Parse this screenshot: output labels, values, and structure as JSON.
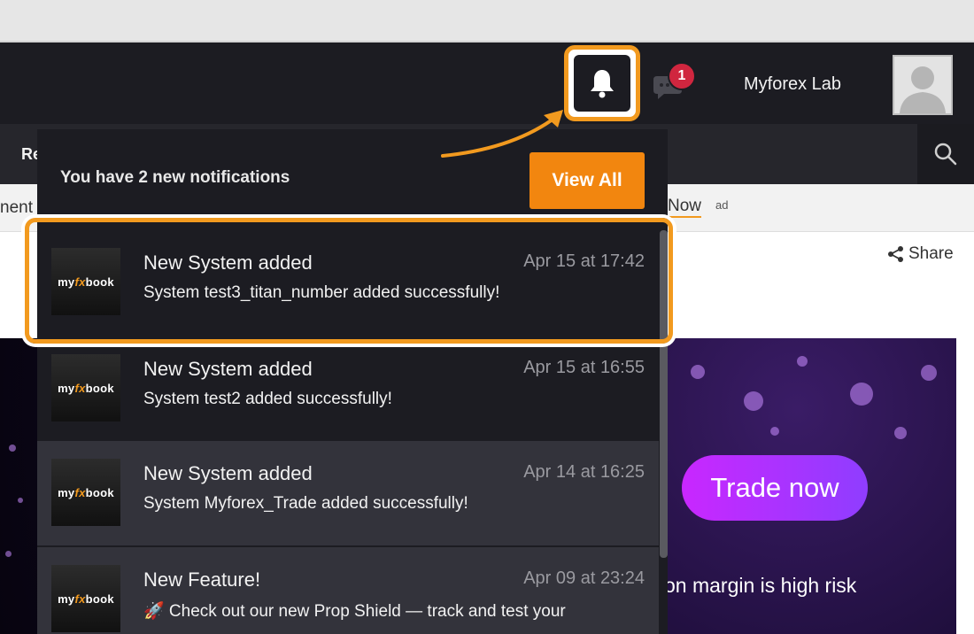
{
  "topbar": {
    "chat_badge": "1",
    "username": "Myforex Lab"
  },
  "navbar": {
    "partial_label": "Re"
  },
  "adbar": {
    "left_text": "nent",
    "right_text": "Now",
    "ad_tag": "ad"
  },
  "share_label": "Share",
  "banner": {
    "cta": "Trade now",
    "disclaimer": "on margin is high risk"
  },
  "notifications": {
    "header": "You have 2 new notifications",
    "view_all": "View All",
    "items": [
      {
        "logo": "myfxbook",
        "title": "New System added",
        "time": "Apr 15 at 17:42",
        "message": "System test3_titan_number added successfully!"
      },
      {
        "logo": "myfxbook",
        "title": "New System added",
        "time": "Apr 15 at 16:55",
        "message": "System test2 added successfully!"
      },
      {
        "logo": "myfxbook",
        "title": "New System added",
        "time": "Apr 14 at 16:25",
        "message": "System Myforex_Trade added successfully!"
      },
      {
        "logo": "myfxbook",
        "title": "New Feature!",
        "time": "Apr 09 at 23:24",
        "message": "🚀 Check out our new Prop Shield — track and test your"
      }
    ]
  },
  "colors": {
    "accent": "#f29a1f",
    "topbar": "#1c1c22",
    "badge": "#d0263f"
  }
}
